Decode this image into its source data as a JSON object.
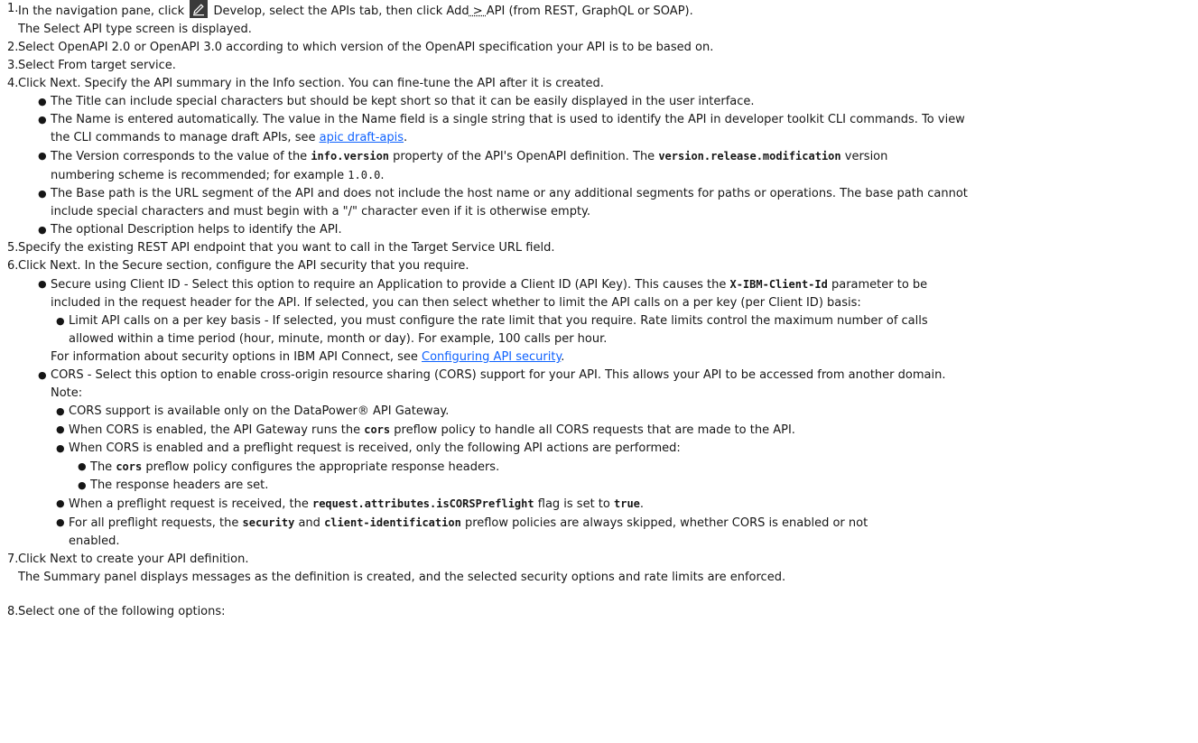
{
  "steps": {
    "s1": {
      "a": "In the navigation pane, click",
      "b": "Develop, select the APIs tab, then click Add",
      "sep": " > ",
      "c": "API (from REST, GraphQL or SOAP).",
      "sub": "The Select API type screen is displayed."
    },
    "s2": "Select OpenAPI 2.0 or OpenAPI 3.0 according to which version of the OpenAPI specification your API is to be based on.",
    "s3": "Select From target service.",
    "s4": {
      "text": "Click Next. Specify the API summary in the Info section. You can fine-tune the API after it is created.",
      "title": "The Title can include special characters but should be kept short so that it can be easily displayed in the user interface.",
      "name_a": "The Name is entered automatically. The value in the Name field is a single string that is used to identify the API in developer toolkit CLI commands. To view",
      "name_b": "the CLI commands to manage draft APIs, see",
      "name_link": "apic draft-apis",
      "name_end": ".",
      "ver_a": "The Version corresponds to the value of the",
      "ver_code1": "info.version",
      "ver_b": "property of the API's OpenAPI definition. The",
      "ver_code2": "version.release.modification",
      "ver_c": "version",
      "ver_d": "numbering scheme is recommended; for example",
      "ver_code3": "1.0.0",
      "ver_end": ".",
      "base_a": "The Base path is the URL segment of the API and does not include the host name or any additional segments for paths or operations. The base path cannot",
      "base_b": "include special characters and must begin with a \"/\" character even if it is otherwise empty.",
      "desc": "The optional Description helps to identify the API."
    },
    "s5": "Specify the existing REST API endpoint that you want to call in the Target Service URL field.",
    "s6": {
      "text": "Click Next. In the Secure section, configure the API security that you require.",
      "client_a": "Secure using Client ID - Select this option to require an Application to provide a Client ID (API Key). This causes the",
      "client_code": "X-IBM-Client-Id",
      "client_b": "parameter to be",
      "client_c": "included in the request header for the API. If selected, you can then select whether to limit the API calls on a per key (per Client ID) basis:",
      "limit_a": "Limit API calls on a per key basis - If selected, you must configure the rate limit that you require. Rate limits control the maximum number of calls",
      "limit_b": "allowed within a time period (hour, minute, month or day). For example, 100 calls per hour.",
      "info_a": "For information about security options in IBM API Connect, see",
      "info_link": "Configuring API security",
      "info_end": ".",
      "cors_a": "CORS - Select this option to enable cross-origin resource sharing (CORS) support for your API. This allows your API to be accessed from another domain.",
      "cors_note": "Note:",
      "n1": "CORS support is available only on the DataPower® API Gateway.",
      "n2_a": "When CORS is enabled, the API Gateway runs the",
      "n2_code": "cors",
      "n2_b": "preflow policy to handle all CORS requests that are made to the API.",
      "n3": "When CORS is enabled and a preflight request is received, only the following API actions are performed:",
      "n3a_a": "The",
      "n3a_code": "cors",
      "n3a_b": "preflow policy configures the appropriate response headers.",
      "n3b": "The response headers are set.",
      "n4_a": "When a preflight request is received, the",
      "n4_code1": "request.attributes.isCORSPreflight",
      "n4_b": "flag is set to",
      "n4_code2": "true",
      "n4_end": ".",
      "n5_a": "For all preflight requests, the",
      "n5_code1": "security",
      "n5_b": "and",
      "n5_code2": "client-identification",
      "n5_c": "preflow policies are always skipped, whether CORS is enabled or not",
      "n5_d": "enabled."
    },
    "s7": {
      "text": "Click Next to create your API definition.",
      "sub": "The Summary panel displays messages as the definition is created, and the selected security options and rate limits are enforced."
    },
    "s8": "Select one of the following options:"
  },
  "numbers": [
    "1.",
    "2.",
    "3.",
    "4.",
    "5.",
    "6.",
    "7.",
    "8."
  ],
  "bullet": "●",
  "icons": {
    "develop": "pencil-icon"
  },
  "colors": {
    "link": "#0f62fe",
    "icon_bg": "#393939",
    "text": "#161616"
  }
}
